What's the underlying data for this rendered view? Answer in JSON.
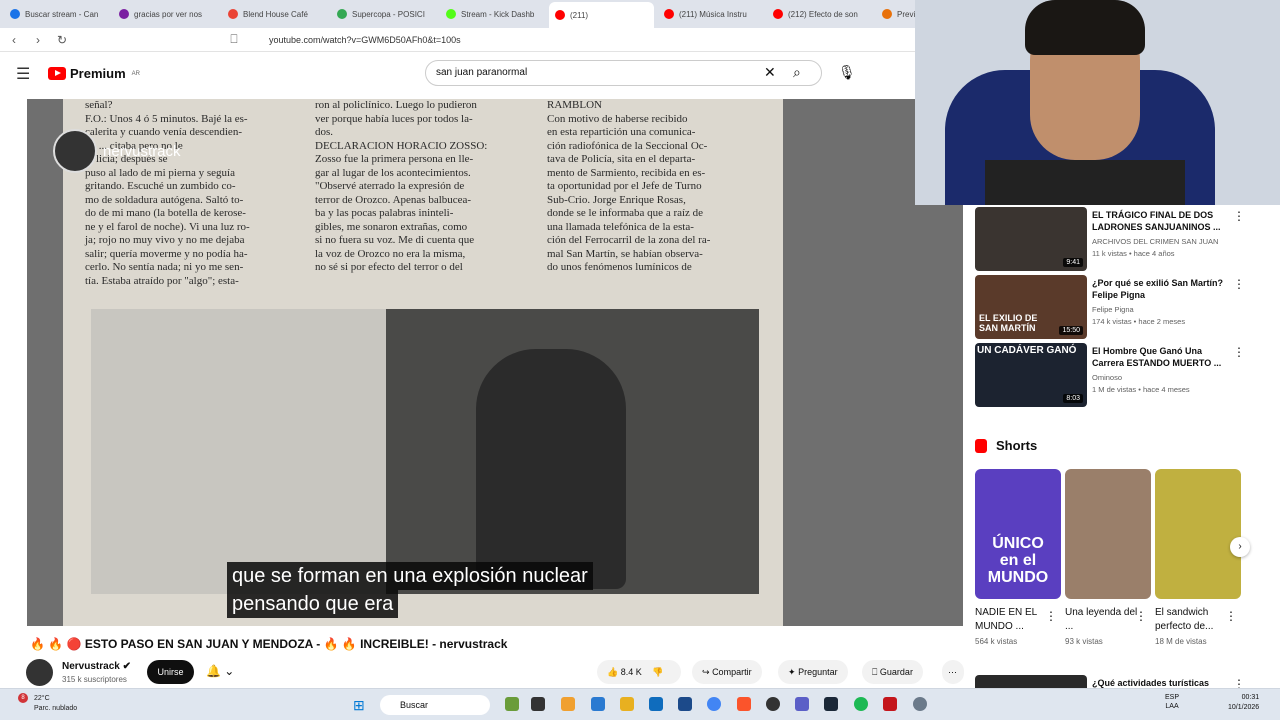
{
  "browser": {
    "tabs": [
      {
        "label": "Buscar stream - Can",
        "color": "#1a73e8"
      },
      {
        "label": "gracias por ver nos",
        "color": "#7b1fa2"
      },
      {
        "label": "Blend House Café",
        "color": "#ea4335"
      },
      {
        "label": "Supercopa - POSICI",
        "color": "#34a853"
      },
      {
        "label": "Stream - Kick Dashb",
        "color": "#53fc18"
      },
      {
        "label": "(211)",
        "color": "#ff0000"
      },
      {
        "label": "(211) Música Instru",
        "color": "#ff0000"
      },
      {
        "label": "(212) Efecto de son",
        "color": "#ff0000"
      },
      {
        "label": "Previsión meteor",
        "color": "#e8710a"
      }
    ],
    "url": "youtube.com/watch?v=GWM6D50AFh0&t=100s"
  },
  "youtube": {
    "logo_text": "Premium",
    "region": "AR",
    "search_query": "san juan paranormal"
  },
  "video": {
    "channel_watermark": "nervustrack",
    "watermark_sub": "YouTube",
    "subtitle_line1": "que se forman en una explosión nuclear",
    "subtitle_line2": "pensando que era",
    "newspaper": {
      "col1": "señal?\nF.O.: Unos 4 ó 5 minutos. Bajé la es-\ncalerita y cuando venía descendien-\ndo ... citaba pero no le\n... licía; después se\npuso al lado de mi pierna y seguía\ngritando. Escuché un zumbido co-\nmo de soldadura autógena. Saltó to-\ndo de mi mano (la botella de kerose-\nne y el farol de noche). Vi una luz ro-\nja; rojo no muy vivo y no me dejaba\nsalir; quería moverme y no podía ha-\ncerlo. No sentía nada; ni yo me sen-\ntía. Estaba atraído por \"algo\"; esta-",
      "col2": "ron al policlínico. Luego lo pudieron\nver porque había luces por todos la-\ndos.\nDECLARACION HORACIO ZOSSO:\nZosso fue la primera persona en lle-\ngar al lugar de los acontecimientos.\n\"Observé aterrado la expresión de\nterror de Orozco. Apenas balbucea-\nba y las pocas palabras ininteli-\ngibles, me sonaron extrañas, como\nsi no fuera su voz. Me di cuenta que\nla voz de Orozco no era la misma,\nno sé si por efecto del terror o del",
      "col3": "RAMBLON\nCon motivo de haberse recibido\nen esta repartición una comunica-\nción radiofónica de la Seccional Oc-\ntava de Policía, sita en el departa-\nmento de Sarmiento, recibida en es-\nta oportunidad por el Jefe de Turno\nSub-Crio. Jorge Enrique Rosas,\ndonde se le informaba que a raíz de\nuna llamada telefónica de la esta-\nción del Ferrocarril de la zona del ra-\nmal San Martín, se habían observa-\ndo unos fenómenos lumínicos de"
    },
    "title": "🔥 🔥 🔴 ESTO PASO EN SAN JUAN Y MENDOZA - 🔥 🔥 INCREIBLE! - nervustrack",
    "channel": "Nervustrack ✔",
    "subscribers": "315 k suscriptores",
    "join_label": "Unirse",
    "likes": "8.4 K",
    "share_label": "Compartir",
    "ask_label": "Preguntar",
    "save_label": "Guardar"
  },
  "sidebar": {
    "recommended": [
      {
        "title": "EL TRÁGICO FINAL DE DOS LADRONES SANJUANINOS ...",
        "channel": "ARCHIVOS DEL CRIMEN SAN JUAN",
        "meta": "11 k vistas • hace 4 años",
        "duration": "9:41"
      },
      {
        "title": "¿Por qué se exilió San Martín? Felipe Pigna",
        "channel": "Felipe Pigna",
        "meta": "174 k vistas • hace 2 meses",
        "duration": "15:50",
        "thumb_text": "EL EXILIO DE SAN MARTÍN"
      },
      {
        "title": "El Hombre Que Ganó Una Carrera ESTANDO MUERTO ...",
        "channel": "Ominoso",
        "meta": "1 M de vistas • hace 4 meses",
        "duration": "8:03",
        "thumb_text": "UN CADÁVER GANÓ"
      }
    ],
    "shorts_label": "Shorts",
    "shorts": [
      {
        "title": "NADIE EN EL MUNDO ...",
        "views": "564 k vistas",
        "thumb_text": "ÚNICO en el MUNDO",
        "color": "#5a3fc0"
      },
      {
        "title": "Una leyenda del ...",
        "views": "93 k vistas",
        "color": "#9a7f6a"
      },
      {
        "title": "El sandwich perfecto de...",
        "views": "18 M de vistas",
        "color": "#c0b040"
      }
    ],
    "next_title": "¿Qué actividades turísticas"
  },
  "taskbar": {
    "weather_temp": "22°C",
    "weather_desc": "Parc. nublado",
    "search_label": "Buscar",
    "lang": "ESP",
    "lang2": "LAA",
    "time": "00:31",
    "date": "10/1/2026",
    "notif_count": "8"
  }
}
